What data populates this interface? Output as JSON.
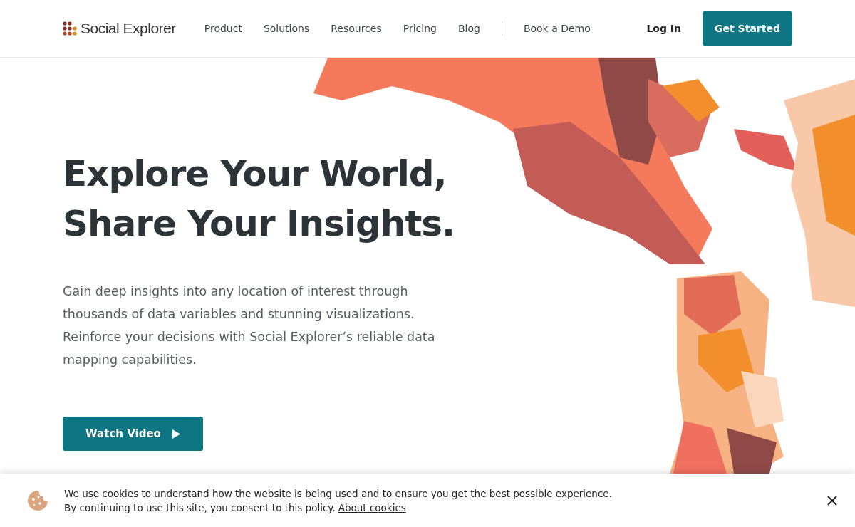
{
  "header": {
    "logo": "Social Explorer",
    "nav": [
      {
        "label": "Product"
      },
      {
        "label": "Solutions"
      },
      {
        "label": "Resources"
      },
      {
        "label": "Pricing"
      },
      {
        "label": "Blog"
      },
      {
        "label": "Book a Demo"
      }
    ],
    "login": "Log In",
    "cta": "Get Started"
  },
  "hero": {
    "title_lines": [
      "Explore Your World,",
      "Share Your Insights."
    ],
    "description": "Gain deep insights into any location of interest through thousands of data variables and stunning visualizations. Reinforce your decisions with Social Explorer’s reliable data mapping capabilities.",
    "button": "Watch Video"
  },
  "cookie_banner": {
    "lines": [
      "We use cookies to understand how the website is being used and to ensure you get the best possible experience.",
      "By continuing to use this site, you consent to this policy."
    ],
    "link": "About cookies"
  }
}
